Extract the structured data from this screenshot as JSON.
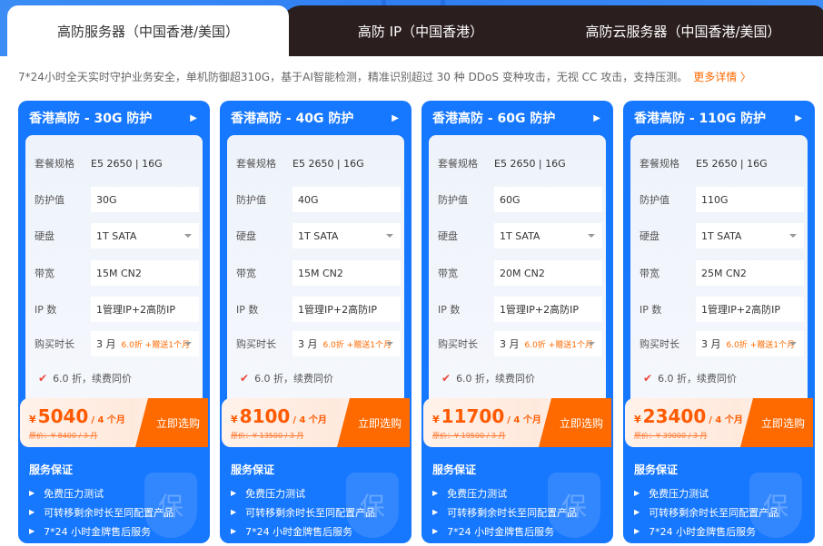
{
  "tabs": [
    {
      "label": "高防服务器（中国香港/美国）"
    },
    {
      "label": "高防 IP（中国香港）"
    },
    {
      "label": "高防云服务器（中国香港/美国）"
    }
  ],
  "description": "7*24小时全天实时守护业务安全，单机防御超310G，基于AI智能检测，精准识别超过 30 种 DDoS 变种攻击，无视 CC 攻击，支持压测。",
  "more_link": "更多详情 〉",
  "labels": {
    "spec": "套餐规格",
    "protection": "防护值",
    "disk": "硬盘",
    "bandwidth": "带宽",
    "ip_count": "IP 数",
    "duration": "购买时长",
    "discount_note": "6.0 折，续费同价",
    "buy": "立即选购",
    "service_title": "服务保证",
    "services": [
      "免费压力测试",
      "可转移剩余时长至同配置产品",
      "7*24 小时金牌售后服务"
    ],
    "shield_char": "保"
  },
  "cards": [
    {
      "title": "香港高防 - 30G 防护",
      "spec": "E5 2650 | 16G",
      "protection": "30G",
      "disk": "1T SATA",
      "bandwidth": "15M CN2",
      "ip": "1管理IP+2高防IP",
      "duration": "3 月",
      "promo": "6.0折 +赠送1个月",
      "currency": "¥",
      "price": "5040",
      "unit": "/ 4 个月",
      "orig": "原价：¥ 8400 / 3 月"
    },
    {
      "title": "香港高防 - 40G 防护",
      "spec": "E5 2650 | 16G",
      "protection": "40G",
      "disk": "1T SATA",
      "bandwidth": "15M CN2",
      "ip": "1管理IP+2高防IP",
      "duration": "3 月",
      "promo": "6.0折 +赠送1个月",
      "currency": "¥",
      "price": "8100",
      "unit": "/ 4 个月",
      "orig": "原价：¥ 13500 / 3 月"
    },
    {
      "title": "香港高防 - 60G 防护",
      "spec": "E5 2650 | 16G",
      "protection": "60G",
      "disk": "1T SATA",
      "bandwidth": "20M CN2",
      "ip": "1管理IP+2高防IP",
      "duration": "3 月",
      "promo": "6.0折 +赠送1个月",
      "currency": "¥",
      "price": "11700",
      "unit": "/ 4 个月",
      "orig": "原价：¥ 19500 / 3 月"
    },
    {
      "title": "香港高防 - 110G 防护",
      "spec": "E5 2650 | 16G",
      "protection": "110G",
      "disk": "1T SATA",
      "bandwidth": "25M CN2",
      "ip": "1管理IP+2高防IP",
      "duration": "3 月",
      "promo": "6.0折 +赠送1个月",
      "currency": "¥",
      "price": "23400",
      "unit": "/ 4 个月",
      "orig": "原价：¥ 39000 / 3 月"
    }
  ]
}
